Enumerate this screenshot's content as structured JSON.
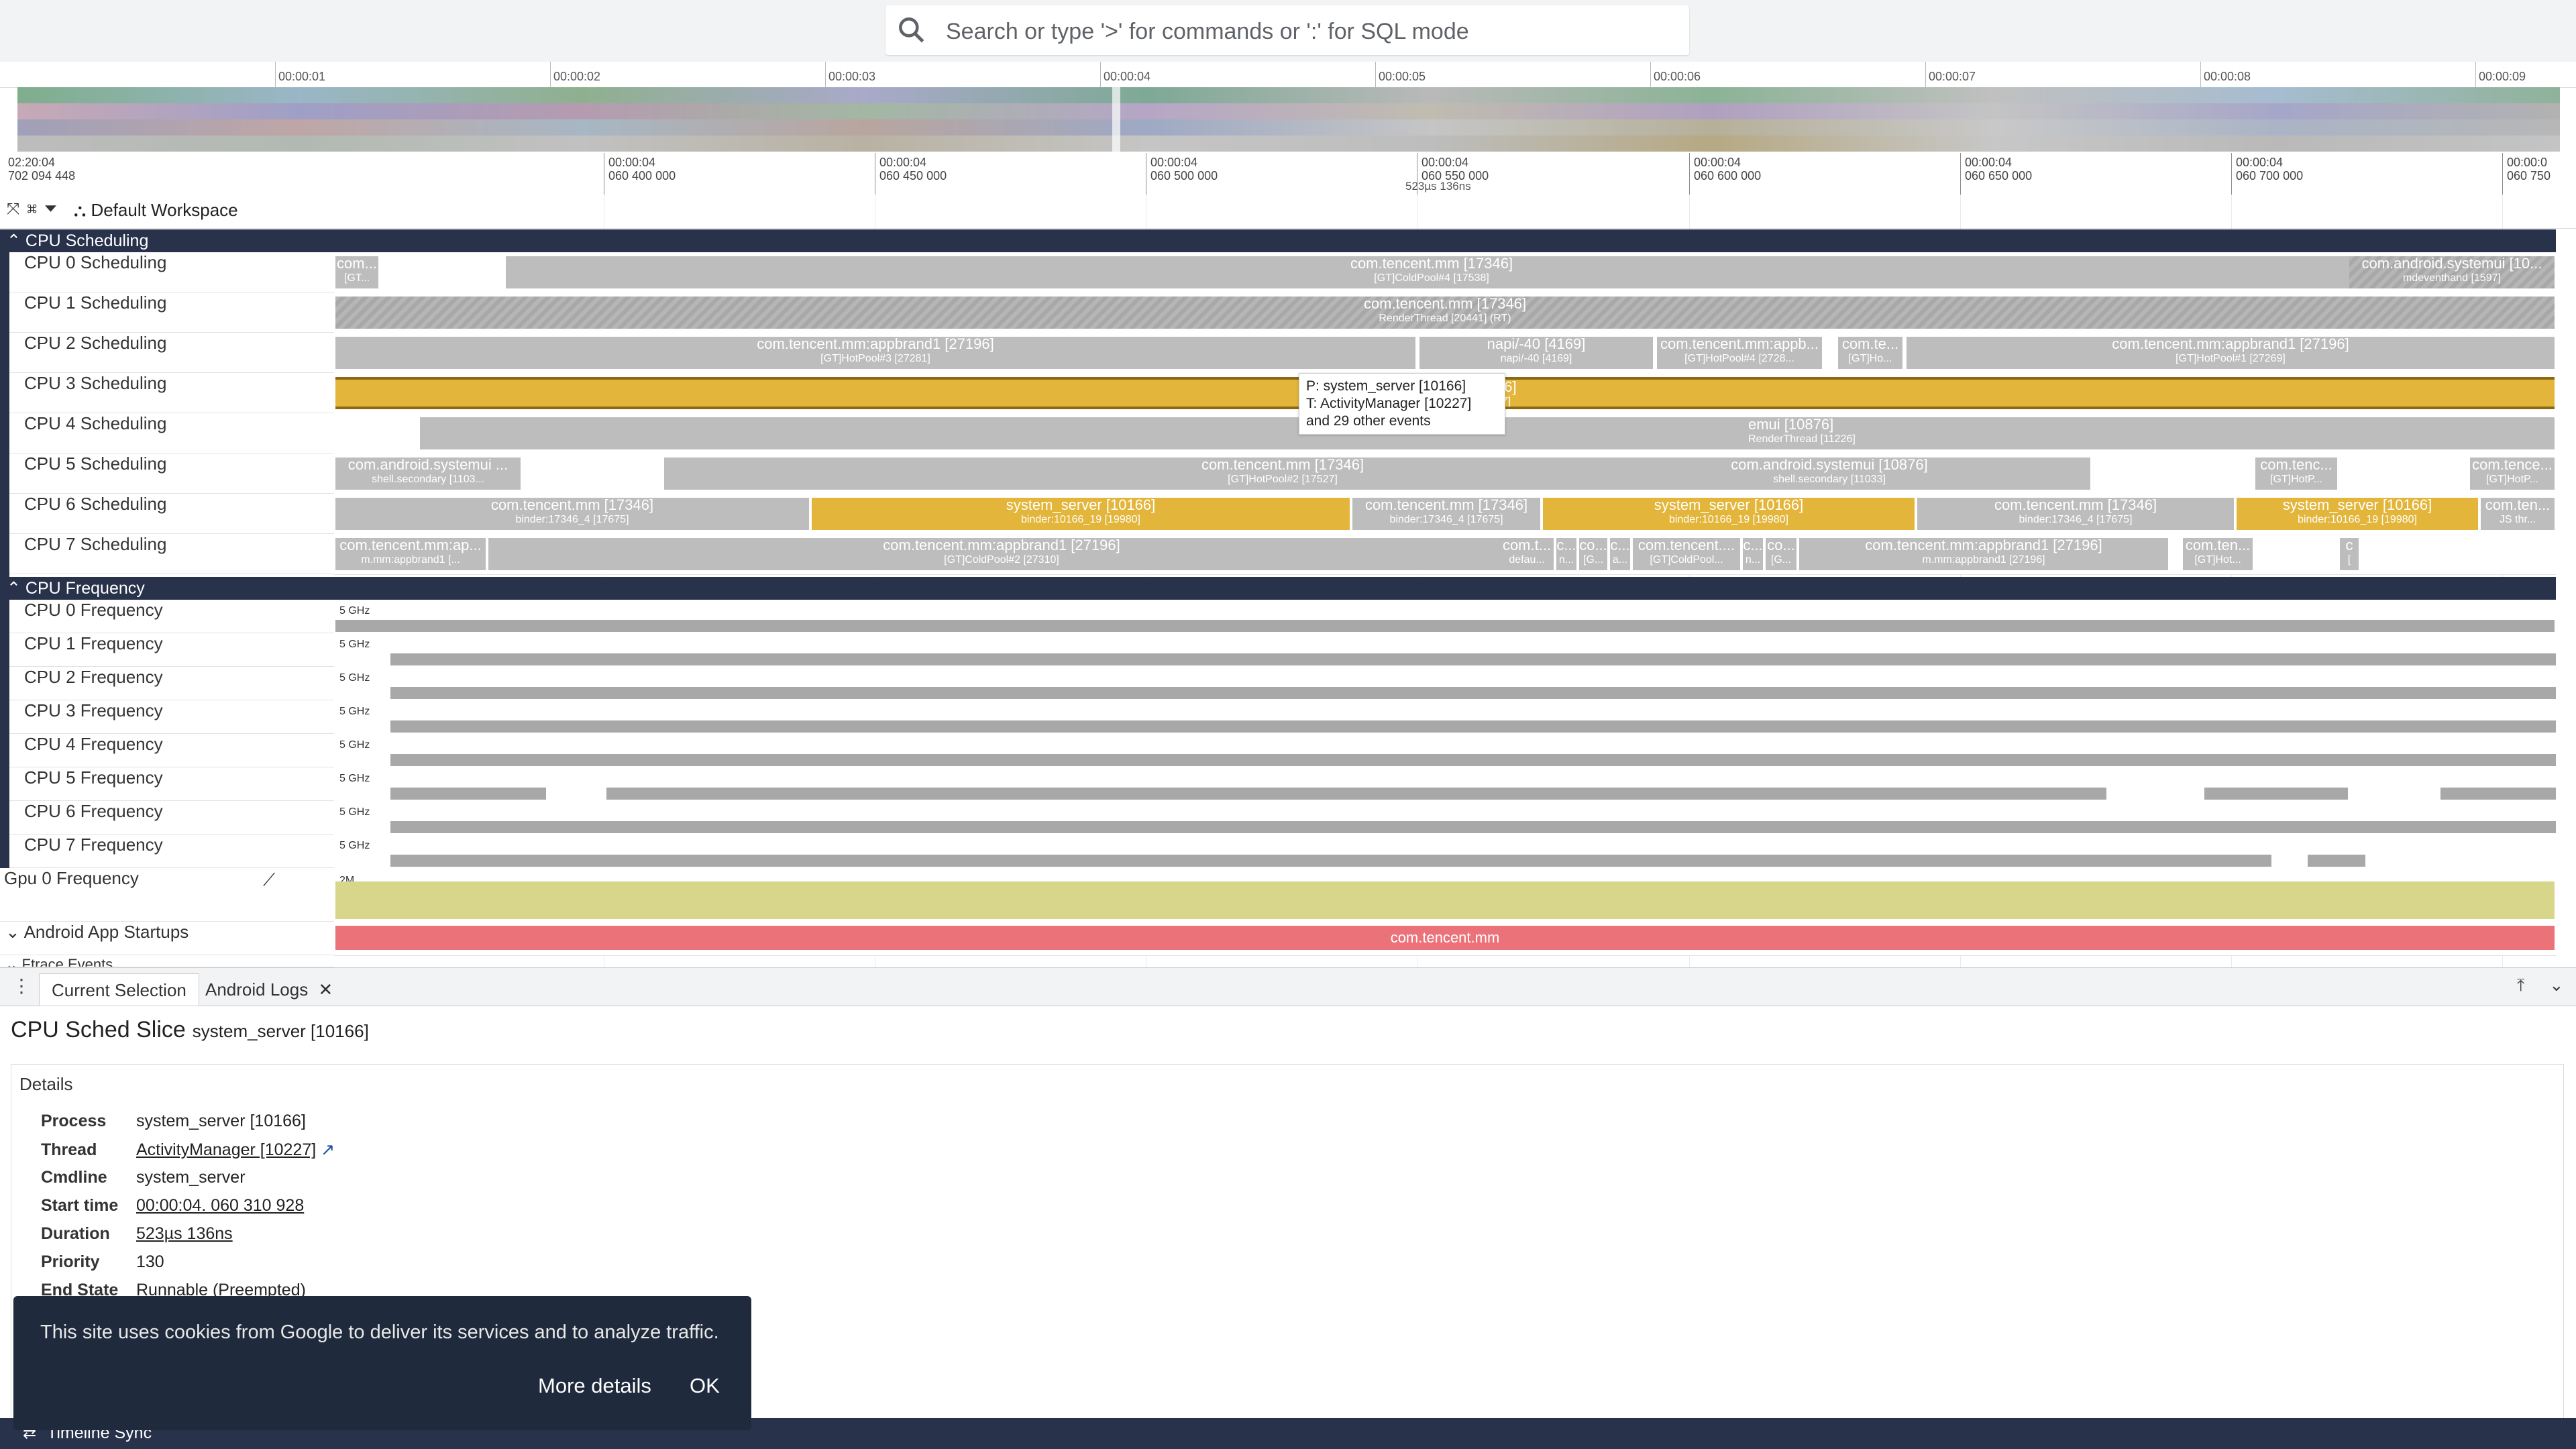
{
  "search": {
    "placeholder": "Search or type '>' for commands or ':' for SQL mode"
  },
  "overview": {
    "ticks": [
      "00:00:01",
      "00:00:02",
      "00:00:03",
      "00:00:04",
      "00:00:05",
      "00:00:06",
      "00:00:07",
      "00:00:08",
      "00:00:09"
    ]
  },
  "timeline": {
    "start_line1": "02:20:04",
    "start_line2": "702 094 448",
    "ticks": [
      {
        "l1": "00:00:04",
        "l2": "060 400 000"
      },
      {
        "l1": "00:00:04",
        "l2": "060 450 000"
      },
      {
        "l1": "00:00:04",
        "l2": "060 500 000"
      },
      {
        "l1": "00:00:04",
        "l2": "060 550 000"
      },
      {
        "l1": "00:00:04",
        "l2": "060 600 000"
      },
      {
        "l1": "00:00:04",
        "l2": "060 650 000"
      },
      {
        "l1": "00:00:04",
        "l2": "060 700 000"
      },
      {
        "l1": "00:00:0",
        "l2": "060 750"
      }
    ],
    "duration_label": "523µs 136ns",
    "workspace": "Default Workspace"
  },
  "groups": {
    "cpu_scheduling": "CPU Scheduling",
    "cpu_frequency": "CPU Frequency",
    "app_startups": "Android App Startups",
    "ftrace": "Ftrace Events"
  },
  "sched_tracks": [
    {
      "name": "CPU 0 Scheduling",
      "slices": [
        {
          "t1": "com...",
          "t2": "[GT..."
        },
        {
          "t1": "com.tencent.mm [17346]",
          "t2": "[GT]ColdPool#4 [17538]"
        },
        {
          "t1": "com.android.systemui [10...",
          "t2": "mdeventhand [1597]"
        }
      ]
    },
    {
      "name": "CPU 1 Scheduling",
      "slices": [
        {
          "t1": "com.tencent.mm [17346]",
          "t2": "RenderThread [20441] (RT)"
        }
      ]
    },
    {
      "name": "CPU 2 Scheduling",
      "slices": [
        {
          "t1": "com.tencent.mm:appbrand1 [27196]",
          "t2": "[GT]HotPool#3 [27281]"
        },
        {
          "t1": "napi/-40 [4169]",
          "t2": "napi/-40 [4169]"
        },
        {
          "t1": "com.tencent.mm:appb...",
          "t2": "[GT]HotPool#4 [2728..."
        },
        {
          "t1": "com.te...",
          "t2": "[GT]Ho..."
        },
        {
          "t1": "com.tencent.mm:appbrand1 [27196]",
          "t2": "[GT]HotPool#1 [27269]"
        }
      ]
    },
    {
      "name": "CPU 3 Scheduling",
      "slices": [
        {
          "t1": "66]",
          "t2": "27]"
        }
      ]
    },
    {
      "name": "CPU 4 Scheduling",
      "slices": [
        {
          "t1": "emui [10876]",
          "t2": "RenderThread [11226]"
        }
      ]
    },
    {
      "name": "CPU 5 Scheduling",
      "slices": [
        {
          "t1": "com.android.systemui ...",
          "t2": "shell.secondary [1103..."
        },
        {
          "t1": "com.tencent.mm [17346]",
          "t2": "[GT]HotPool#2 [17527]"
        },
        {
          "t1": "com.android.systemui [10876]",
          "t2": "shell.secondary [11033]"
        },
        {
          "t1": "com.tenc...",
          "t2": "[GT]HotP..."
        },
        {
          "t1": "com.tence...",
          "t2": "[GT]HotP..."
        }
      ]
    },
    {
      "name": "CPU 6 Scheduling",
      "slices": [
        {
          "t1": "com.tencent.mm [17346]",
          "t2": "binder:17346_4 [17675]"
        },
        {
          "t1": "system_server [10166]",
          "t2": "binder:10166_19 [19980]"
        },
        {
          "t1": "com.tencent.mm [17346]",
          "t2": "binder:17346_4 [17675]"
        },
        {
          "t1": "system_server [10166]",
          "t2": "binder:10166_19 [19980]"
        },
        {
          "t1": "com.tencent.mm [17346]",
          "t2": "binder:17346_4 [17675]"
        },
        {
          "t1": "system_server [10166]",
          "t2": "binder:10166_19 [19980]"
        },
        {
          "t1": "com.ten...",
          "t2": "JS thr..."
        }
      ]
    },
    {
      "name": "CPU 7 Scheduling",
      "slices": [
        {
          "t1": "com.tencent.mm:ap...",
          "t2": "m.mm:appbrand1 [..."
        },
        {
          "t1": "com.tencent.mm:appbrand1 [27196]",
          "t2": "[GT]ColdPool#2 [27310]"
        },
        {
          "t1": "com.t...",
          "t2": "defau..."
        },
        {
          "t1": "c...",
          "t2": "n..."
        },
        {
          "t1": "co...",
          "t2": "[G..."
        },
        {
          "t1": "c...",
          "t2": "a..."
        },
        {
          "t1": "com.tencent....",
          "t2": "[GT]ColdPool..."
        },
        {
          "t1": "c...",
          "t2": "n..."
        },
        {
          "t1": "co...",
          "t2": "[G..."
        },
        {
          "t1": "com.tencent.mm:appbrand1 [27196]",
          "t2": "m.mm:appbrand1 [27196]"
        },
        {
          "t1": "com.ten...",
          "t2": "[GT]Hot..."
        },
        {
          "t1": "c",
          "t2": "["
        }
      ]
    }
  ],
  "freq_tracks": [
    {
      "name": "CPU 0 Frequency",
      "scale": "5 GHz"
    },
    {
      "name": "CPU 1 Frequency",
      "scale": "5 GHz"
    },
    {
      "name": "CPU 2 Frequency",
      "scale": "5 GHz"
    },
    {
      "name": "CPU 3 Frequency",
      "scale": "5 GHz"
    },
    {
      "name": "CPU 4 Frequency",
      "scale": "5 GHz"
    },
    {
      "name": "CPU 5 Frequency",
      "scale": "5 GHz"
    },
    {
      "name": "CPU 6 Frequency",
      "scale": "5 GHz"
    },
    {
      "name": "CPU 7 Frequency",
      "scale": "5 GHz"
    }
  ],
  "gpu_track": {
    "name": "Gpu 0 Frequency",
    "scale": "2M"
  },
  "app_startup_slice": "com.tencent.mm",
  "tooltip": {
    "line1": "P: system_server [10166]",
    "line2": "T: ActivityManager [10227]",
    "line3": "and 29 other events"
  },
  "tabs": [
    {
      "label": "Current Selection"
    },
    {
      "label": "Android Logs"
    }
  ],
  "selection": {
    "title": "CPU Sched Slice",
    "subtitle": "system_server [10166]",
    "details_header": "Details",
    "rows": [
      {
        "k": "Process",
        "v": "system_server [10166]"
      },
      {
        "k": "Thread",
        "v": "ActivityManager [10227]"
      },
      {
        "k": "Cmdline",
        "v": "system_server"
      },
      {
        "k": "Start time",
        "v": "00:00:04. 060 310 928"
      },
      {
        "k": "Duration",
        "v": "523µs 136ns"
      },
      {
        "k": "Priority",
        "v": "130"
      },
      {
        "k": "End State",
        "v": "Runnable (Preempted)"
      }
    ]
  },
  "cookie": {
    "message": "This site uses cookies from Google to deliver its services and to analyze traffic.",
    "more": "More details",
    "ok": "OK"
  },
  "statusbar": {
    "label": "Timeline Sync"
  },
  "colors": {
    "header": "#28324b",
    "sched": "#bdbdbd",
    "selected": "#e3b53a",
    "gpu": "#d8d68a",
    "startup": "#ec727a"
  }
}
